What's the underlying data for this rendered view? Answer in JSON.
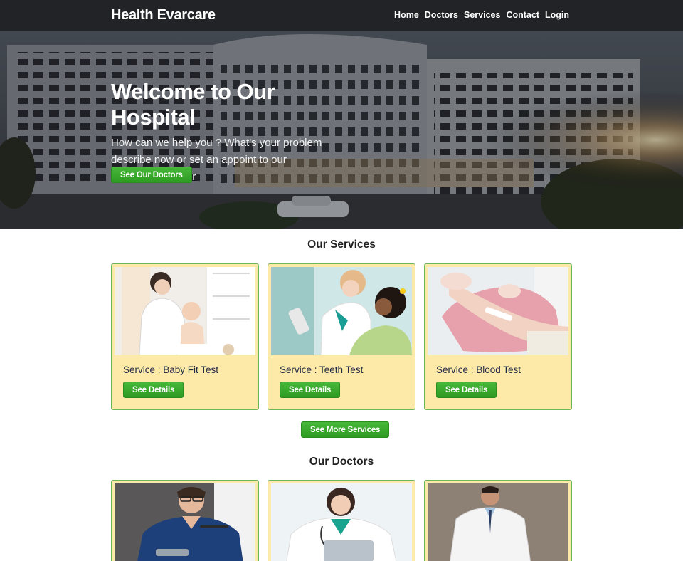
{
  "navbar": {
    "brand": "Health Evarcare",
    "links": [
      "Home",
      "Doctors",
      "Services",
      "Contact",
      "Login"
    ]
  },
  "hero": {
    "title": "Welcome to Our Hospital",
    "text": "How can we help you ? What's your problem describe now or set an appoint to our experiance doctor",
    "button": "See Our Doctors"
  },
  "services": {
    "heading": "Our Services",
    "items": [
      {
        "title": "Service : Baby Fit Test",
        "button": "See Details"
      },
      {
        "title": "Service : Teeth Test",
        "button": "See Details"
      },
      {
        "title": "Service : Blood Test",
        "button": "See Details"
      }
    ],
    "more_button": "See More Services"
  },
  "doctors": {
    "heading": "Our Doctors"
  },
  "colors": {
    "navbar": "#222326",
    "button_green": "#3aa82e",
    "card_bg": "#fdeaa9",
    "card_border": "#6bb85a"
  }
}
